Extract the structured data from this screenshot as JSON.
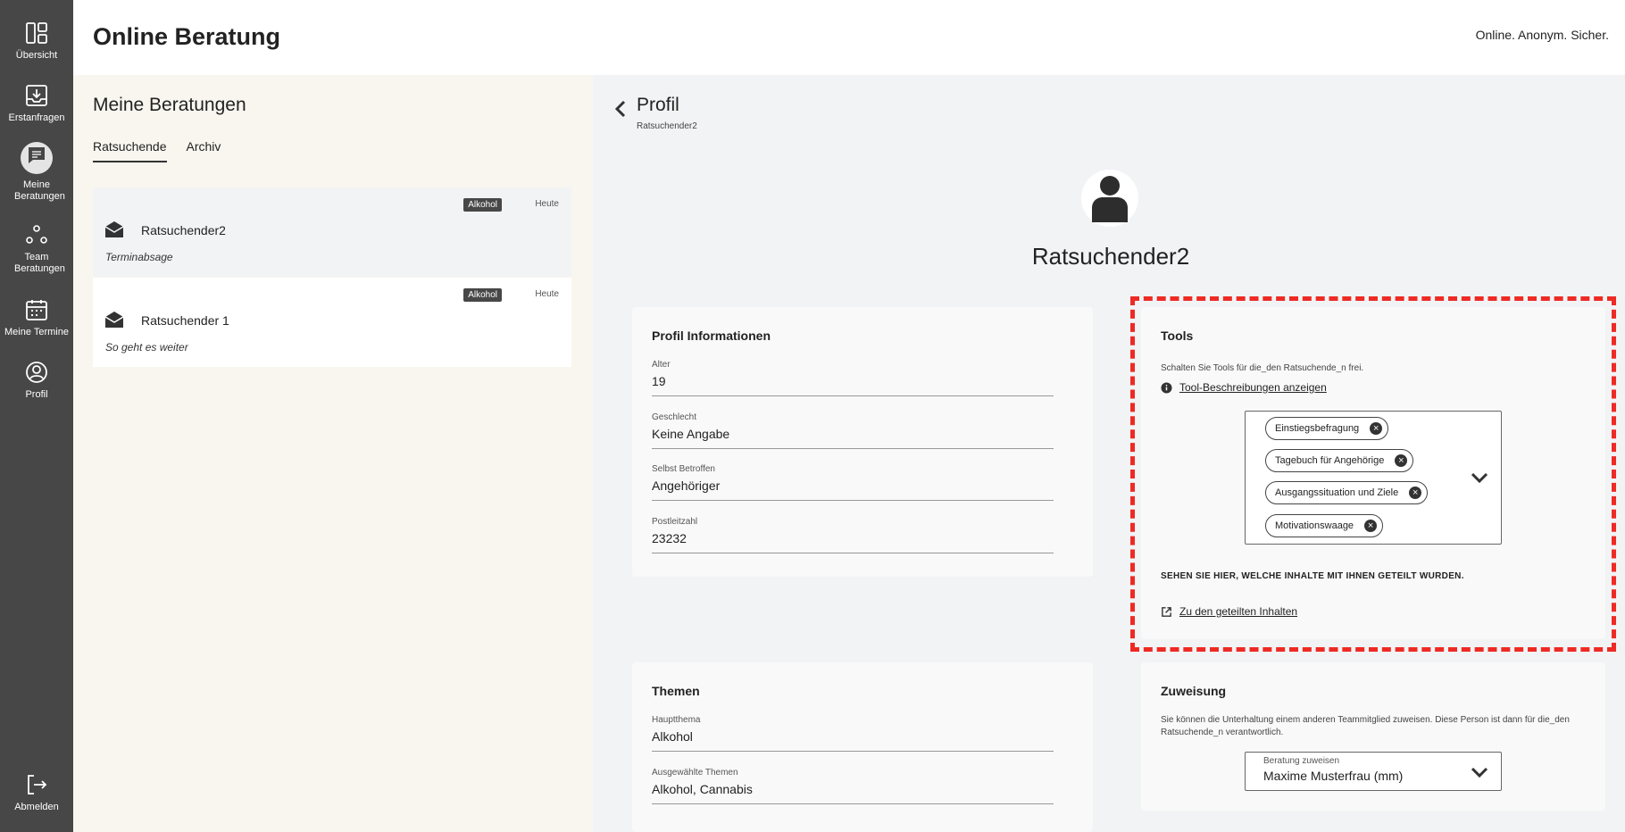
{
  "nav": {
    "items": [
      {
        "label": "Übersicht",
        "icon": "dashboard-icon"
      },
      {
        "label": "Erstanfragen",
        "icon": "inbox-icon"
      },
      {
        "label": "Meine Beratungen",
        "icon": "chat-icon"
      },
      {
        "label": "Team Beratungen",
        "icon": "team-icon"
      },
      {
        "label": "Meine Termine",
        "icon": "calendar-icon"
      },
      {
        "label": "Profil",
        "icon": "profile-icon"
      }
    ],
    "logout": "Abmelden"
  },
  "header": {
    "title": "Online Beratung",
    "tagline": "Online. Anonym. Sicher."
  },
  "list": {
    "title": "Meine Beratungen",
    "tabs": [
      "Ratsuchende",
      "Archiv"
    ],
    "sessions": [
      {
        "name": "Ratsuchender2",
        "badge": "Alkohol",
        "date": "Heute",
        "message": "Terminabsage"
      },
      {
        "name": "Ratsuchender 1",
        "badge": "Alkohol",
        "date": "Heute",
        "message": "So geht es weiter"
      }
    ]
  },
  "profile": {
    "title": "Profil",
    "subtitle": "Ratsuchender2",
    "name": "Ratsuchender2",
    "info": {
      "title": "Profil Informationen",
      "fields": [
        {
          "label": "Alter",
          "value": "19"
        },
        {
          "label": "Geschlecht",
          "value": "Keine Angabe"
        },
        {
          "label": "Selbst Betroffen",
          "value": "Angehöriger"
        },
        {
          "label": "Postleitzahl",
          "value": "23232"
        }
      ]
    },
    "tools": {
      "title": "Tools",
      "description": "Schalten Sie Tools für die_den Ratsuchende_n frei.",
      "info_link": "Tool-Beschreibungen anzeigen",
      "chips": [
        "Einstiegsbefragung",
        "Tagebuch für Angehörige",
        "Ausgangssituation und Ziele",
        "Motivationswaage"
      ],
      "shared_heading": "SEHEN SIE HIER, WELCHE INHALTE MIT IHNEN GETEILT WURDEN.",
      "shared_link": "Zu den geteilten Inhalten"
    },
    "topics": {
      "title": "Themen",
      "fields": [
        {
          "label": "Hauptthema",
          "value": "Alkohol"
        },
        {
          "label": "Ausgewählte Themen",
          "value": "Alkohol, Cannabis"
        }
      ]
    },
    "assign": {
      "title": "Zuweisung",
      "description": "Sie können die Unterhaltung einem anderen Teammitglied zuweisen. Diese Person ist dann für die_den Ratsuchende_n verantwortlich.",
      "select_label": "Beratung zuweisen",
      "select_value": "Maxime Musterfrau (mm)"
    }
  },
  "colors": {
    "nav_bg": "#474747",
    "highlight": "#ee2a24",
    "list_bg": "#f9f6ef"
  }
}
